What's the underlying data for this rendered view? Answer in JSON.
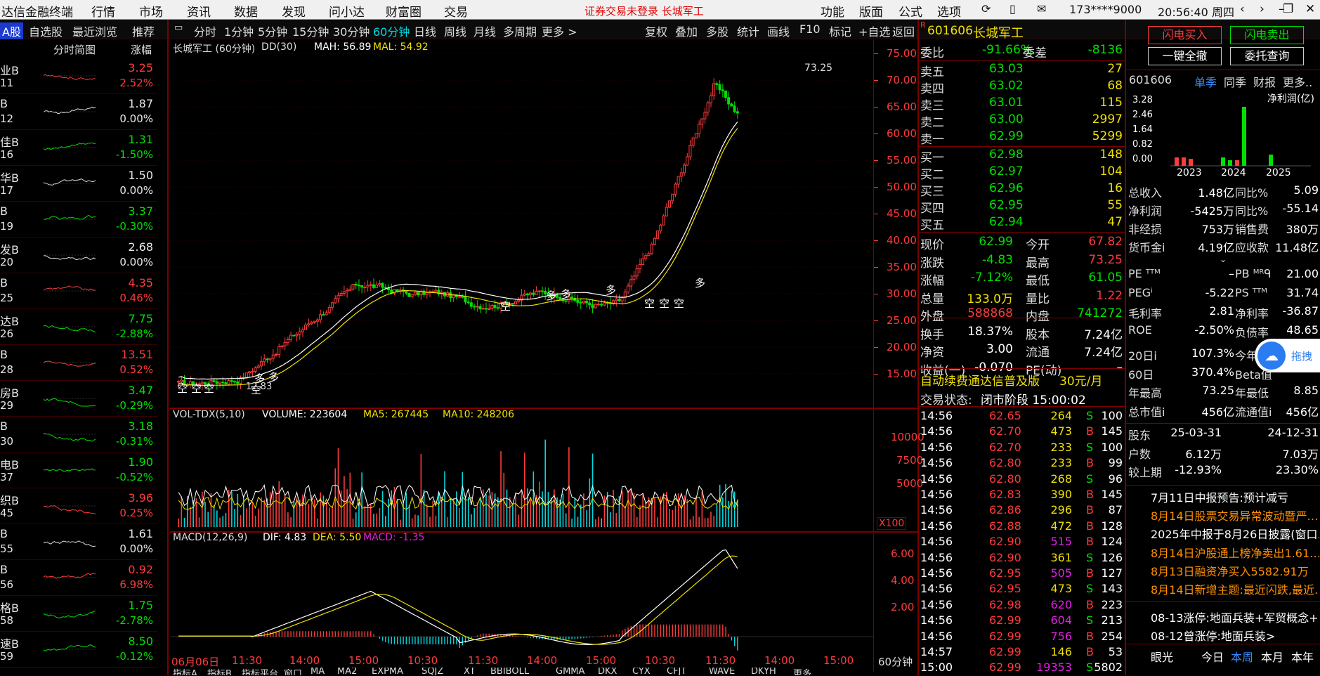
{
  "menubar": {
    "app_title": "达信金融终端",
    "items": [
      "行情",
      "市场",
      "资讯",
      "数据",
      "发现",
      "问小达",
      "财富圈",
      "交易"
    ],
    "notice": "证券交易未登录  长城军工",
    "right_items": [
      "功能",
      "版面",
      "公式",
      "选项"
    ],
    "user": "173****9000",
    "clock": "20:56:40 周四"
  },
  "tabbar": {
    "left_tabs": [
      "A股",
      "自选股",
      "最近浏览",
      "推荐"
    ],
    "period_tabs": [
      "分时",
      "1分钟",
      "5分钟",
      "15分钟",
      "30分钟",
      "60分钟",
      "日线",
      "周线",
      "月线",
      "多周期",
      "更多 >"
    ],
    "active_period": "60分钟",
    "tools": [
      "复权",
      "叠加",
      "多股",
      "统计",
      "画线",
      "F10",
      "标记",
      "+自选",
      "返回"
    ]
  },
  "watchlist": {
    "col_headers": [
      "分时简图",
      "涨幅"
    ],
    "rows": [
      {
        "name": "业B",
        "code": "11",
        "price": "3.25",
        "pct": "2.52%",
        "dir": "up"
      },
      {
        "name": "B",
        "code": "12",
        "price": "1.87",
        "pct": "0.00%",
        "dir": "fl"
      },
      {
        "name": "佳B",
        "code": "16",
        "price": "1.31",
        "pct": "-1.50%",
        "dir": "dn"
      },
      {
        "name": "华B",
        "code": "17",
        "price": "1.50",
        "pct": "0.00%",
        "dir": "fl"
      },
      {
        "name": "B",
        "code": "19",
        "price": "3.37",
        "pct": "-0.30%",
        "dir": "dn"
      },
      {
        "name": "发B",
        "code": "20",
        "price": "2.68",
        "pct": "0.00%",
        "dir": "fl"
      },
      {
        "name": "B",
        "code": "25",
        "price": "4.35",
        "pct": "0.46%",
        "dir": "up"
      },
      {
        "name": "达B",
        "code": "26",
        "price": "7.75",
        "pct": "-2.88%",
        "dir": "dn"
      },
      {
        "name": "B",
        "code": "28",
        "price": "13.51",
        "pct": "0.52%",
        "dir": "up"
      },
      {
        "name": "房B",
        "code": "29",
        "price": "3.47",
        "pct": "-0.29%",
        "dir": "dn"
      },
      {
        "name": "B",
        "code": "30",
        "price": "3.18",
        "pct": "-0.31%",
        "dir": "dn"
      },
      {
        "name": "电B",
        "code": "37",
        "price": "1.90",
        "pct": "-0.52%",
        "dir": "dn"
      },
      {
        "name": "织B",
        "code": "45",
        "price": "3.96",
        "pct": "0.25%",
        "dir": "up"
      },
      {
        "name": "B",
        "code": "55",
        "price": "1.61",
        "pct": "0.00%",
        "dir": "fl"
      },
      {
        "name": "B",
        "code": "56",
        "price": "0.92",
        "pct": "6.98%",
        "dir": "up"
      },
      {
        "name": "格B",
        "code": "58",
        "price": "1.75",
        "pct": "-2.78%",
        "dir": "dn"
      },
      {
        "name": "速B",
        "code": "59",
        "price": "8.50",
        "pct": "-0.12%",
        "dir": "dn"
      }
    ]
  },
  "price_panel": {
    "title": "长城军工 (60分钟)",
    "indicator": "DD(30)",
    "mah": "MAH: 56.89",
    "mal": "MAL: 54.92",
    "peak_label": "73.25",
    "low_label": "12.83",
    "signals_kong": "空",
    "signals_duo": "多",
    "y_ticks": [
      "75.00",
      "70.00",
      "65.00",
      "60.00",
      "55.00",
      "50.00",
      "45.00",
      "40.00",
      "35.00",
      "30.00",
      "25.00",
      "20.00",
      "15.00"
    ]
  },
  "volume_panel": {
    "label": "VOL-TDX(5,10)",
    "volume": "VOLUME: 223604",
    "ma5": "MA5: 267445",
    "ma10": "MA10: 248206",
    "y_ticks": [
      "10000",
      "7500",
      "5000"
    ],
    "unit": "X100"
  },
  "macd_panel": {
    "label": "MACD(12,26,9)",
    "dif": "DIF: 4.83",
    "dea": "DEA: 5.50",
    "macd": "MACD: -1.35",
    "y_ticks": [
      "6.00",
      "4.00",
      "2.00"
    ]
  },
  "time_axis": {
    "labels": [
      "06月06日",
      "11:30",
      "14:00",
      "15:00",
      "10:30",
      "11:30",
      "14:00",
      "15:00",
      "10:30",
      "11:30",
      "14:00",
      "15:00"
    ],
    "period": "60分钟"
  },
  "bottom_tabs": [
    "指标A",
    "指标B",
    "指标平台",
    "窗口",
    "MA",
    "MA2",
    "EXPMA",
    "SQJZ",
    "XT",
    "BBIBOLL",
    "GMMA",
    "DKX",
    "CYX",
    "CFJT",
    "WAVE",
    "DKYH",
    "更多"
  ],
  "quote": {
    "code": "601606",
    "name": "长城军工",
    "weibi_label": "委比",
    "weibi": "-91.66%",
    "weicha_label": "委差",
    "weicha": "-8136",
    "asks": [
      {
        "label": "卖五",
        "price": "63.03",
        "vol": "27"
      },
      {
        "label": "卖四",
        "price": "63.02",
        "vol": "68"
      },
      {
        "label": "卖三",
        "price": "63.01",
        "vol": "115"
      },
      {
        "label": "卖二",
        "price": "63.00",
        "vol": "2997"
      },
      {
        "label": "卖一",
        "price": "62.99",
        "vol": "5299"
      }
    ],
    "bids": [
      {
        "label": "买一",
        "price": "62.98",
        "vol": "148"
      },
      {
        "label": "买二",
        "price": "62.97",
        "vol": "104"
      },
      {
        "label": "买三",
        "price": "62.96",
        "vol": "16"
      },
      {
        "label": "买四",
        "price": "62.95",
        "vol": "55"
      },
      {
        "label": "买五",
        "price": "62.94",
        "vol": "47"
      }
    ],
    "stats": [
      {
        "l1": "现价",
        "v1": "62.99",
        "l2": "今开",
        "v2": "67.82",
        "c1": "dn",
        "c2": "up"
      },
      {
        "l1": "涨跌",
        "v1": "-4.83",
        "l2": "最高",
        "v2": "73.25",
        "c1": "dn",
        "c2": "up"
      },
      {
        "l1": "涨幅",
        "v1": "-7.12%",
        "l2": "最低",
        "v2": "61.05",
        "c1": "dn",
        "c2": "dn"
      },
      {
        "l1": "总量",
        "v1": "133.0万",
        "l2": "量比",
        "v2": "1.22",
        "c1": "yl",
        "c2": "up"
      },
      {
        "l1": "外盘",
        "v1": "588868",
        "l2": "内盘",
        "v2": "741272",
        "c1": "up",
        "c2": "dn"
      },
      {
        "l1": "换手",
        "v1": "18.37%",
        "l2": "股本",
        "v2": "7.24亿",
        "c1": "wt",
        "c2": "wt"
      },
      {
        "l1": "净资",
        "v1": "3.00",
        "l2": "流通",
        "v2": "7.24亿",
        "c1": "wt",
        "c2": "wt"
      },
      {
        "l1": "收益(一)",
        "v1": "-0.070",
        "l2": "PE(动)",
        "v2": "–",
        "c1": "wt",
        "c2": "wt"
      }
    ],
    "promo": "自动续费通达信普及版",
    "promo_price": "30元/月",
    "status_label": "交易状态:",
    "status": "闭市阶段 15:00:02"
  },
  "ticks": [
    {
      "t": "14:56",
      "p": "62.65",
      "v": "264",
      "s": "S",
      "n": "100"
    },
    {
      "t": "14:56",
      "p": "62.70",
      "v": "473",
      "s": "B",
      "n": "145"
    },
    {
      "t": "14:56",
      "p": "62.70",
      "v": "233",
      "s": "S",
      "n": "100"
    },
    {
      "t": "14:56",
      "p": "62.80",
      "v": "233",
      "s": "B",
      "n": "99"
    },
    {
      "t": "14:56",
      "p": "62.80",
      "v": "268",
      "s": "S",
      "n": "96"
    },
    {
      "t": "14:56",
      "p": "62.83",
      "v": "390",
      "s": "B",
      "n": "145"
    },
    {
      "t": "14:56",
      "p": "62.86",
      "v": "296",
      "s": "B",
      "n": "87"
    },
    {
      "t": "14:56",
      "p": "62.88",
      "v": "472",
      "s": "B",
      "n": "128"
    },
    {
      "t": "14:56",
      "p": "62.90",
      "v": "515",
      "s": "B",
      "n": "124"
    },
    {
      "t": "14:56",
      "p": "62.90",
      "v": "361",
      "s": "S",
      "n": "126"
    },
    {
      "t": "14:56",
      "p": "62.95",
      "v": "505",
      "s": "B",
      "n": "127"
    },
    {
      "t": "14:56",
      "p": "62.95",
      "v": "473",
      "s": "S",
      "n": "143"
    },
    {
      "t": "14:56",
      "p": "62.98",
      "v": "620",
      "s": "B",
      "n": "223"
    },
    {
      "t": "14:56",
      "p": "62.99",
      "v": "604",
      "s": "S",
      "n": "213"
    },
    {
      "t": "14:56",
      "p": "62.99",
      "v": "756",
      "s": "B",
      "n": "254"
    },
    {
      "t": "14:57",
      "p": "62.99",
      "v": "146",
      "s": "B",
      "n": "53"
    },
    {
      "t": "15:00",
      "p": "62.99",
      "v": "19353",
      "s": "S",
      "n": "5802"
    }
  ],
  "trade_buttons": {
    "flash_buy": "闪电买入",
    "flash_sell": "闪电卖出",
    "cancel_all": "一键全撤",
    "query": "委托查询"
  },
  "fundamentals": {
    "code": "601606",
    "tabs": [
      "单季",
      "同季",
      "财报",
      "更多.."
    ],
    "chart_title": "净利润(亿)",
    "y_ticks": [
      "3.28",
      "2.46",
      "1.64",
      "0.82",
      "0.00"
    ],
    "years": [
      "2023",
      "2024",
      "2025"
    ],
    "rows": [
      {
        "l1": "总收入",
        "v1": "1.48亿",
        "l2": "同比%",
        "v2": "5.09"
      },
      {
        "l1": "净利润",
        "v1": "-5425万",
        "l2": "同比%",
        "v2": "-55.14"
      },
      {
        "l1": "非经损",
        "v1": "753万",
        "l2": "销售费",
        "v2": "380万"
      },
      {
        "l1": "货币金i",
        "v1": "4.19亿",
        "l2": "应收款",
        "v2": "11.48亿"
      }
    ],
    "ratios": [
      {
        "l1": "PE ᵀᵀᴹ",
        "v1": "–",
        "l2": "PB ᴹᴿᑫ",
        "v2": "21.00"
      },
      {
        "l1": "PEGⁱ",
        "v1": "-5.22",
        "l2": "PS ᵀᵀᴹ",
        "v2": "31.74"
      },
      {
        "l1": "毛利率",
        "v1": "2.81",
        "l2": "净利率",
        "v2": "-36.87"
      },
      {
        "l1": "ROE",
        "v1": "-2.50%",
        "l2": "负债率",
        "v2": "48.65"
      }
    ],
    "perf": [
      {
        "l1": "20日i",
        "v1": "107.3%",
        "l2": "今年",
        "v2": ""
      },
      {
        "l1": "60日",
        "v1": "370.4%",
        "l2": "Beta值",
        "v2": ""
      },
      {
        "l1": "年最高",
        "v1": "73.25",
        "l2": "年最低",
        "v2": "8.85"
      },
      {
        "l1": "总市值i",
        "v1": "456亿",
        "l2": "流通值i",
        "v2": "456亿"
      }
    ],
    "holders": [
      {
        "l1": "股东",
        "v1": "25-03-31",
        "v2": "24-12-31"
      },
      {
        "l1": "户数",
        "v1": "6.12万",
        "v2": "7.03万"
      },
      {
        "l1": "较上期",
        "v1": "-12.93%",
        "v2": "23.30%"
      }
    ],
    "float_button": "拖拽"
  },
  "news": [
    {
      "text": "7月11日中报预告:预计减亏",
      "c": "wt"
    },
    {
      "text": "8月14日股票交易异常波动暨严…",
      "c": "or"
    },
    {
      "text": "2025年中报于8月26日披露(窗口…",
      "c": "wt"
    },
    {
      "text": "8月14日沪股通上榜净卖出1.61…",
      "c": "or"
    },
    {
      "text": "8月13日融资净买入5582.91万",
      "c": "or"
    },
    {
      "text": "8月14日新增主题:最近闪跌,最近…",
      "c": "or"
    },
    {
      "text": "08-13涨停:地面兵装+军贸概念+…",
      "c": "wt"
    },
    {
      "text": "08-12曾涨停:地面兵装>",
      "c": "wt"
    }
  ],
  "bottom_right": {
    "label": "眼光",
    "tabs": [
      "今日",
      "本周",
      "本月",
      "本年"
    ]
  }
}
